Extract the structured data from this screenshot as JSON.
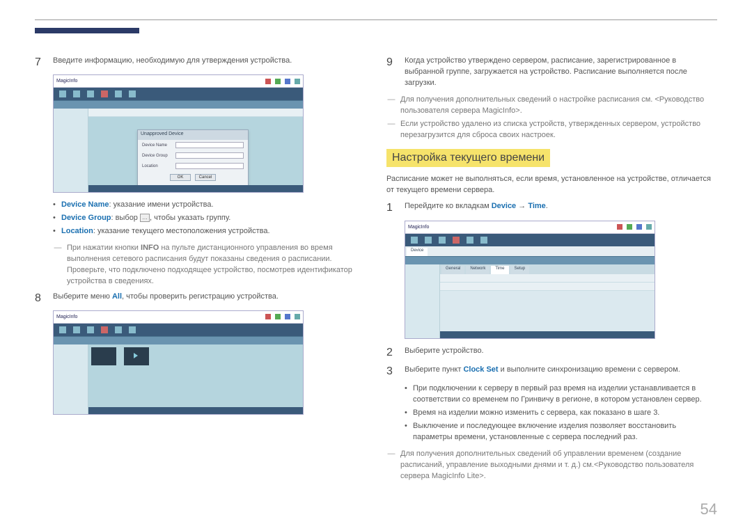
{
  "pageNumber": "54",
  "left": {
    "step7": {
      "num": "7",
      "text": "Введите информацию, необходимую для утверждения устройства."
    },
    "bullets": {
      "deviceNameKey": "Device Name",
      "deviceNameText": ": указание имени устройства.",
      "deviceGroupKey": "Device Group",
      "deviceGroupText1": ": выбор ",
      "deviceGroupText2": ", чтобы указать группу.",
      "locationKey": "Location",
      "locationText": ": указание текущего местоположения устройства."
    },
    "note1a": "При нажатии кнопки ",
    "note1info": "INFO",
    "note1b": " на пульте дистанционного управления во время выполнения сетевого расписания будут показаны сведения о расписании. Проверьте, что подключено подходящее устройство, посмотрев идентификатор устройства в сведениях.",
    "step8": {
      "num": "8",
      "text1": "Выберите меню ",
      "all": "All",
      "text2": ", чтобы проверить регистрацию устройства."
    },
    "ss": {
      "logo": "MagicInfo",
      "dlgTitle": "Unapproved Device",
      "dlgDevice": "Device Name",
      "dlgGroup": "Device Group",
      "dlgLocation": "Location",
      "ok": "OK",
      "cancel": "Cancel"
    }
  },
  "right": {
    "step9": {
      "num": "9",
      "text": "Когда устройство утверждено сервером, расписание, зарегистрированное в выбранной группе, загружается на устройство. Расписание выполняется после загрузки."
    },
    "note1": "Для получения дополнительных сведений о настройке расписания см. <Руководство пользователя сервера MagicInfo>.",
    "note2": "Если устройство удалено из списка устройств, утвержденных сервером, устройство перезагрузится для сброса своих настроек.",
    "sectionTitle": "Настройка текущего времени",
    "sectionIntro": "Расписание может не выполняться, если время, установленное на устройстве, отличается от текущего времени сервера.",
    "step1": {
      "num": "1",
      "text1": "Перейдите ко вкладкам ",
      "device": "Device",
      "arrow": " → ",
      "time": "Time",
      "text2": "."
    },
    "step2": {
      "num": "2",
      "text": "Выберите устройство."
    },
    "step3": {
      "num": "3",
      "text1": "Выберите пункт ",
      "clock": "Clock Set",
      "text2": " и выполните синхронизацию времени с сервером."
    },
    "bullets": {
      "b1": "При подключении к серверу в первый раз время на изделии устанавливается в соответствии со временем по Гринвичу в регионе, в котором установлен сервер.",
      "b2": "Время на изделии можно изменить с сервера, как показано в шаге 3.",
      "b3": "Выключение и последующее включение изделия позволяет восстановить параметры времени, установленные с сервера последний раз."
    },
    "note3": "Для получения дополнительных сведений об управлении временем (создание расписаний, управление выходными днями и т. д.) см.<Руководство пользователя сервера MagicInfo Lite>.",
    "ss": {
      "tabDevice": "Device",
      "tabTime": "Time"
    }
  }
}
